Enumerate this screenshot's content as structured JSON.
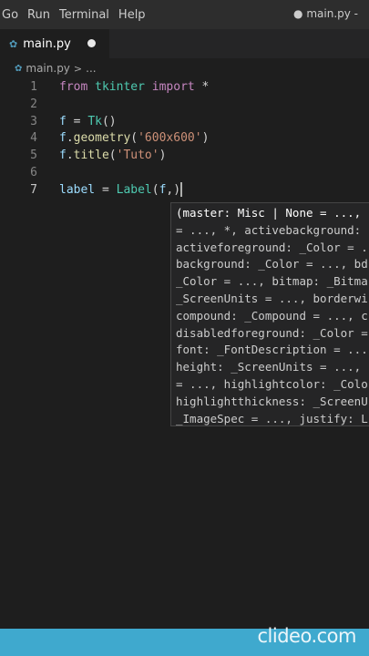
{
  "menubar": {
    "items": [
      "Go",
      "Run",
      "Terminal",
      "Help"
    ],
    "window_title": "● main.py -"
  },
  "tab": {
    "py_icon": "python-file-icon",
    "label": "main.py"
  },
  "breadcrumb": {
    "file": "main.py",
    "separator": ">",
    "symbol": "..."
  },
  "editor": {
    "active_line": 7,
    "lines": [
      {
        "n": "1",
        "tokens": [
          [
            "kw",
            "from"
          ],
          [
            "op",
            " "
          ],
          [
            "mod",
            "tkinter"
          ],
          [
            "op",
            " "
          ],
          [
            "kw",
            "import"
          ],
          [
            "op",
            " *"
          ]
        ]
      },
      {
        "n": "2",
        "tokens": []
      },
      {
        "n": "3",
        "tokens": [
          [
            "var",
            "f"
          ],
          [
            "op",
            " = "
          ],
          [
            "cls",
            "Tk"
          ],
          [
            "op",
            "()"
          ]
        ]
      },
      {
        "n": "4",
        "tokens": [
          [
            "var",
            "f"
          ],
          [
            "op",
            "."
          ],
          [
            "fn",
            "geometry"
          ],
          [
            "op",
            "("
          ],
          [
            "str",
            "'600x600'"
          ],
          [
            "op",
            ")"
          ]
        ]
      },
      {
        "n": "5",
        "tokens": [
          [
            "var",
            "f"
          ],
          [
            "op",
            "."
          ],
          [
            "fn",
            "title"
          ],
          [
            "op",
            "("
          ],
          [
            "str",
            "'Tuto'"
          ],
          [
            "op",
            ")"
          ]
        ]
      },
      {
        "n": "6",
        "tokens": []
      },
      {
        "n": "7",
        "tokens": [
          [
            "var",
            "label"
          ],
          [
            "op",
            " = "
          ],
          [
            "cls",
            "Label"
          ],
          [
            "op",
            "("
          ],
          [
            "var",
            "f"
          ],
          [
            "op",
            ",)"
          ]
        ]
      }
    ]
  },
  "signature_help": {
    "lines": [
      "(master: Misc | None = ...,",
      "= ..., *, activebackground:",
      "activeforeground: _Color = ..",
      "background: _Color = ..., bd",
      "_Color = ..., bitmap: _Bitma",
      "_ScreenUnits = ..., borderwi",
      "compound: _Compound = ..., c",
      "disabledforeground: _Color =",
      "font: _FontDescription = ...",
      "height: _ScreenUnits = ...,",
      "= ..., highlightcolor: _Colo",
      "highlightthickness: _ScreenU",
      "_ImageSpec = ..., justify: L"
    ]
  },
  "watermark": {
    "text": "clideo.com",
    "bar_color": "#3fa9ce"
  }
}
